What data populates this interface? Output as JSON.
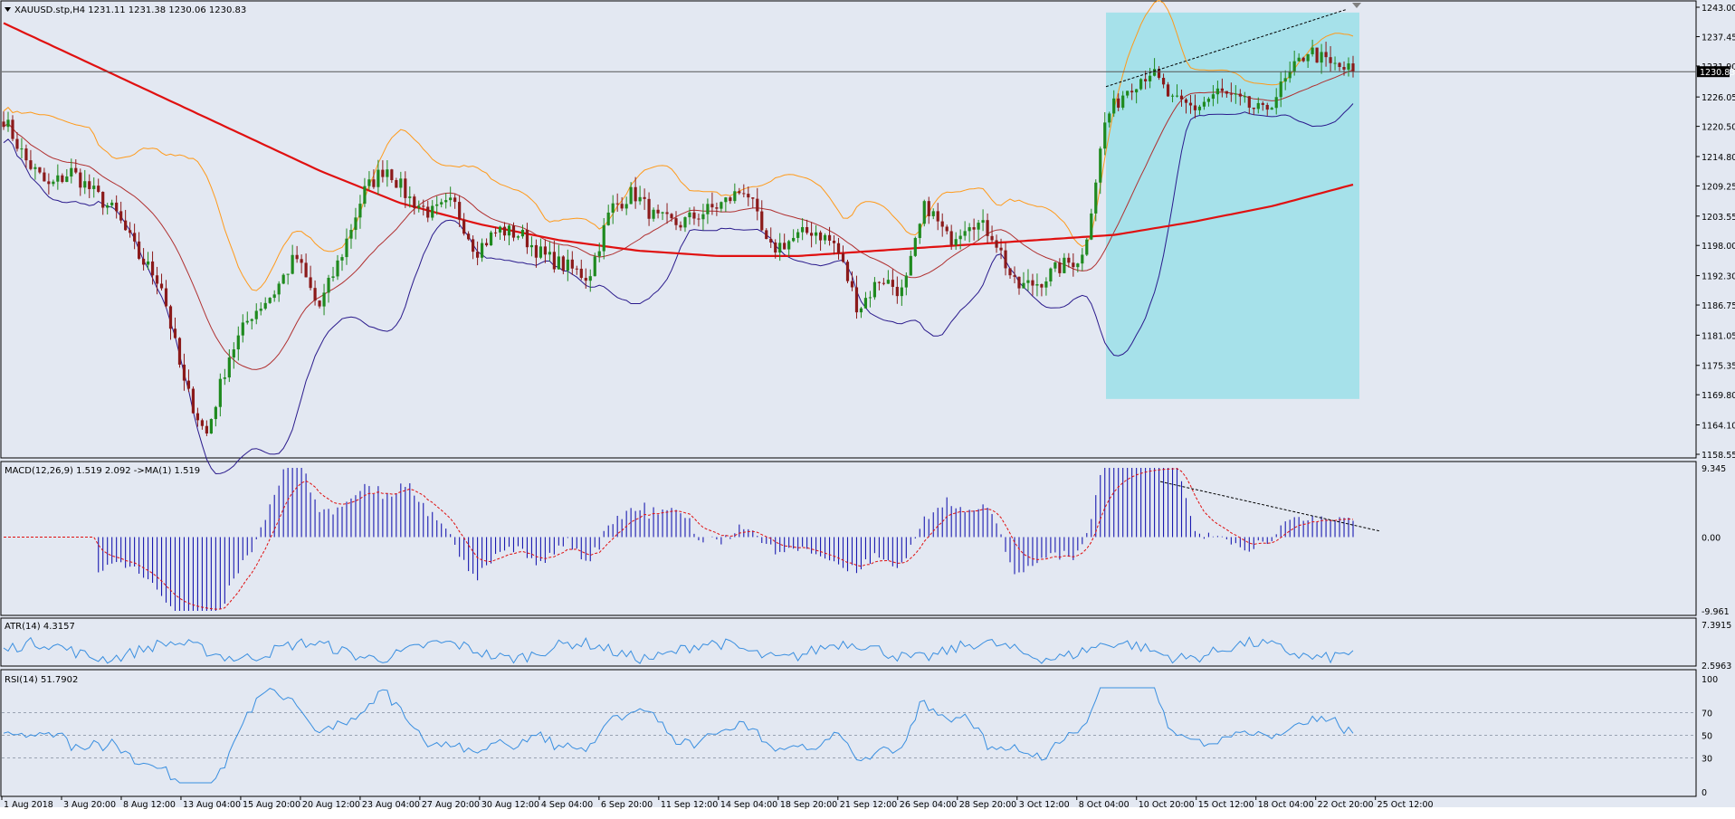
{
  "colors": {
    "background": "#e3e8f2",
    "frame": "#000000",
    "grid": "#9aa3b2",
    "up_candle": "#1f8a1f",
    "down_candle": "#8b1a1a",
    "bb_upper": "#ff9a1a",
    "bb_middle": "#b03030",
    "bb_lower": "#2a1a8c",
    "ma_long": "#e01010",
    "highlight_box": "#a6e1ea",
    "macd_hist": "#1a1ab0",
    "macd_signal": "#e01010",
    "atr_line": "#3a8fe0",
    "rsi_line": "#3a8fe0",
    "level_line": "#2a2a2a"
  },
  "main_panel": {
    "header": "XAUUSD.stp,H4  1231.11 1231.38 1230.06 1230.83",
    "price_labels": [
      "1243.00",
      "1237.45",
      "1231.90",
      "1226.05",
      "1220.50",
      "1214.80",
      "1209.25",
      "1203.55",
      "1198.00",
      "1192.30",
      "1186.75",
      "1181.05",
      "1175.35",
      "1169.80",
      "1164.10",
      "1158.55"
    ],
    "current_price": "1230.83"
  },
  "macd_panel": {
    "header": "MACD(12,26,9) 1.519 2.092  ->MA(1) 1.519",
    "labels": [
      "9.345",
      "0.00",
      "-9.961"
    ]
  },
  "atr_panel": {
    "header": "ATR(14) 4.3157",
    "labels": [
      "7.3915",
      "2.5963"
    ]
  },
  "rsi_panel": {
    "header": "RSI(14) 51.7902",
    "labels": [
      "100",
      "70",
      "50",
      "30",
      "0"
    ]
  },
  "time_labels": [
    "1 Aug 2018",
    "3 Aug 20:00",
    "8 Aug 12:00",
    "13 Aug 04:00",
    "15 Aug 20:00",
    "20 Aug 12:00",
    "23 Aug 04:00",
    "27 Aug 20:00",
    "30 Aug 12:00",
    "4 Sep 04:00",
    "6 Sep 20:00",
    "11 Sep 12:00",
    "14 Sep 04:00",
    "18 Sep 20:00",
    "21 Sep 12:00",
    "26 Sep 04:00",
    "28 Sep 20:00",
    "3 Oct 12:00",
    "8 Oct 04:00",
    "10 Oct 20:00",
    "15 Oct 12:00",
    "18 Oct 04:00",
    "22 Oct 20:00",
    "25 Oct 12:00"
  ],
  "chart_data": [
    {
      "type": "candlestick",
      "title": "XAUUSD.stp,H4",
      "ylim": [
        1158.55,
        1243.0
      ],
      "x_labels": [
        "1 Aug 2018",
        "3 Aug 20:00",
        "8 Aug 12:00",
        "13 Aug 04:00",
        "15 Aug 20:00",
        "20 Aug 12:00",
        "23 Aug 04:00",
        "27 Aug 20:00",
        "30 Aug 12:00",
        "4 Sep 04:00",
        "6 Sep 20:00",
        "11 Sep 12:00",
        "14 Sep 04:00",
        "18 Sep 20:00",
        "21 Sep 12:00",
        "26 Sep 04:00",
        "28 Sep 20:00",
        "3 Oct 12:00",
        "8 Oct 04:00",
        "10 Oct 20:00",
        "15 Oct 12:00",
        "18 Oct 04:00",
        "22 Oct 20:00",
        "25 Oct 12:00"
      ],
      "close_anchors": [
        1222,
        1214,
        1209,
        1212,
        1208,
        1204,
        1196,
        1191,
        1172,
        1162,
        1177,
        1185,
        1189,
        1196,
        1186,
        1196,
        1208,
        1213,
        1207,
        1204,
        1206,
        1197,
        1201,
        1200,
        1196,
        1194,
        1192,
        1205,
        1208,
        1203,
        1202,
        1204,
        1206,
        1209,
        1197,
        1199,
        1201,
        1198,
        1186,
        1192,
        1189,
        1206,
        1199,
        1203,
        1200,
        1190,
        1191,
        1194,
        1196,
        1222,
        1228,
        1231,
        1225,
        1224,
        1227,
        1225,
        1223,
        1229,
        1235,
        1232,
        1231
      ],
      "ma_long_anchors": [
        1240,
        1233,
        1226,
        1219,
        1212,
        1206,
        1202,
        1199,
        1197,
        1196,
        1196,
        1197,
        1198,
        1199,
        1200,
        1202.5,
        1205.5,
        1209.5
      ],
      "highlight_box": {
        "x_from": 1005,
        "x_to": 1110,
        "y_from": 1169.0,
        "y_to": 1242.0
      },
      "trendline": [
        [
          1005,
          1228
        ],
        [
          1088,
          1242.5
        ]
      ],
      "current_price": 1230.83
    },
    {
      "type": "bar",
      "title": "MACD(12,26,9)",
      "ylim": [
        -9.961,
        9.345
      ],
      "macd": 1.519,
      "signal": 2.092
    },
    {
      "type": "line",
      "title": "ATR(14)",
      "ylim": [
        2.5963,
        7.3915
      ],
      "last": 4.3157
    },
    {
      "type": "line",
      "title": "RSI(14)",
      "ylim": [
        0,
        100
      ],
      "levels": [
        30,
        50,
        70
      ],
      "last": 51.7902
    }
  ]
}
